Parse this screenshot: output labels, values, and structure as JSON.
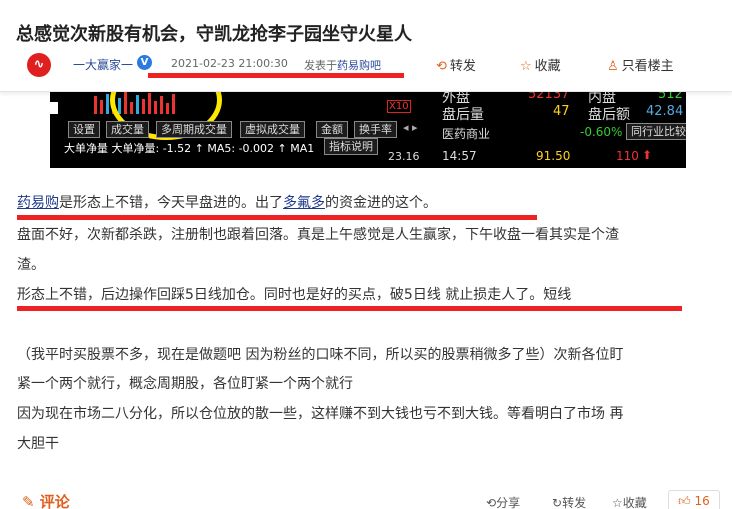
{
  "post": {
    "title": "总感觉次新股有机会，守凯龙抢李子园坐守火星人",
    "author": "一大赢家一",
    "avatar_text": "∿",
    "date": "2021-02-23 21:00:30",
    "posted_in_prefix": "发表于",
    "posted_in_bar": "药易购吧"
  },
  "actions": {
    "share": "转发",
    "favorite": "收藏",
    "author_only": "只看楼主"
  },
  "stock_panel": {
    "tabs": [
      "设置",
      "成交量",
      "多周期成交量",
      "虚拟成交量",
      "金额",
      "换手率"
    ],
    "x10": "X10",
    "indicator": "大单净量  大单净量: -1.52 ↑ MA5: -0.002 ↑ MA1",
    "indicator_btn": "指标说明",
    "price_left": "23.16",
    "right": {
      "outer": "外盘",
      "outer_val": "52137",
      "inner": "内盘",
      "inner_val": "512",
      "after_vol": "盘后量",
      "after_vol_val": "47",
      "after_amt": "盘后额",
      "after_amt_val": "42.84",
      "industry": "医药商业",
      "industry_pct": "-0.60%",
      "industry_compare": "同行业比较",
      "time": "14:57",
      "price": "91.50",
      "vol": "110"
    }
  },
  "article": {
    "p1_link1": "药易购",
    "p1_mid": "是形态上不错，今天早盘进的。出了",
    "p1_link2": "多氟多",
    "p1_end": "的资金进的这个。",
    "p2_line1": "盘面不好，次新都杀跌，注册制也跟着回落。真是上午感觉是人生赢家，下午收盘一看其实是个渣",
    "p2_line2": "渣。",
    "p3": "形态上不错，后边操作回踩5日线加仓。同时也是好的买点，破5日线 就止损走人了。短线",
    "p4_line1": "（我平时买股票不多，现在是做题吧  因为粉丝的口味不同，所以买的股票稍微多了些）次新各位盯",
    "p4_line2": "紧一个两个就行，概念周期股，各位盯紧一个两个就行",
    "p5_line1": "因为现在市场二八分化，所以仓位放的散一些，这样赚不到大钱也亏不到大钱。等看明白了市场 再",
    "p5_line2": "大胆干"
  },
  "footer": {
    "comment": "评论",
    "share": "分享",
    "forward": "转发",
    "favorite": "收藏",
    "like_count": "16"
  }
}
